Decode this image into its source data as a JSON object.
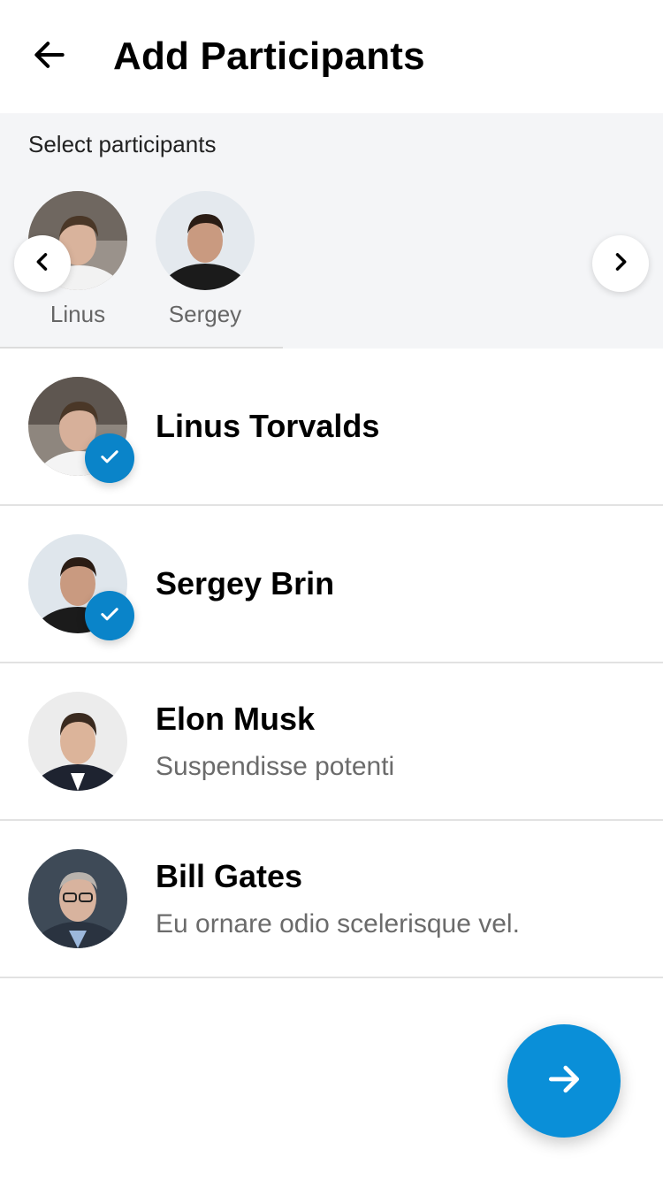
{
  "header": {
    "title": "Add Participants",
    "back_icon": "arrow-left-icon"
  },
  "selected": {
    "label": "Select participants",
    "chips": [
      {
        "name": "Linus"
      },
      {
        "name": "Sergey"
      }
    ],
    "prev_icon": "chevron-left-icon",
    "next_icon": "chevron-right-icon"
  },
  "contacts": [
    {
      "name": "Linus Torvalds",
      "subtitle": "",
      "selected": true
    },
    {
      "name": "Sergey Brin",
      "subtitle": "",
      "selected": true
    },
    {
      "name": "Elon Musk",
      "subtitle": "Suspendisse potenti",
      "selected": false
    },
    {
      "name": "Bill Gates",
      "subtitle": "Eu ornare odio scelerisque vel.",
      "selected": false
    }
  ],
  "fab": {
    "icon": "arrow-right-icon"
  },
  "colors": {
    "accent": "#0a8fd8",
    "check": "#0a84c9",
    "section_bg": "#f4f5f7"
  }
}
